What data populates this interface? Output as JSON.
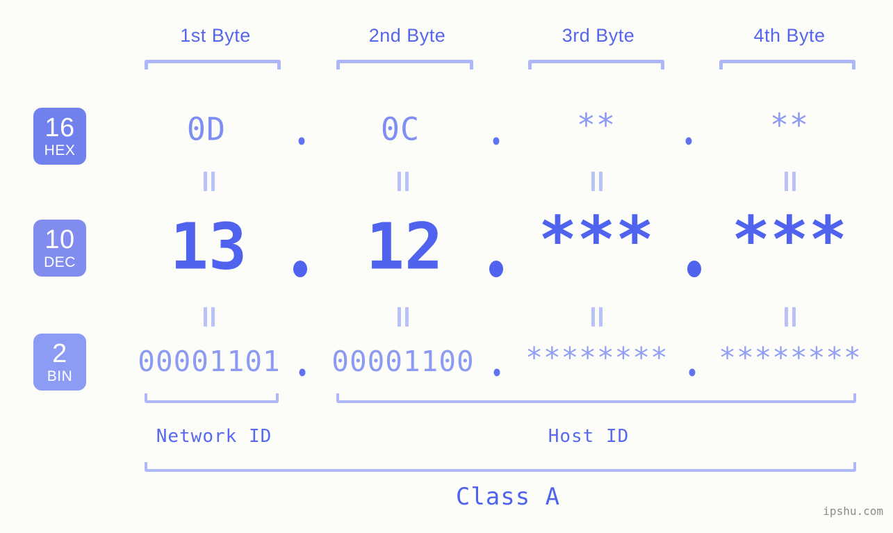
{
  "meta": {
    "background_color": "#fcfdf9",
    "accent_color": "#4f63ee",
    "light_accent_color": "#adb7f7",
    "watermark": "ipshu.com"
  },
  "columns": [
    {
      "label": "1st Byte"
    },
    {
      "label": "2nd Byte"
    },
    {
      "label": "3rd Byte"
    },
    {
      "label": "4th Byte"
    }
  ],
  "rows": [
    {
      "badge_number": "16",
      "badge_name": "HEX",
      "badge_color": "#7080ec",
      "values": [
        "0D",
        "0C",
        "**",
        "**"
      ],
      "separator": "."
    },
    {
      "badge_number": "10",
      "badge_name": "DEC",
      "badge_color": "#808cee",
      "values": [
        "13",
        "12",
        "***",
        "***"
      ],
      "separator": "."
    },
    {
      "badge_number": "2",
      "badge_name": "BIN",
      "badge_color": "#8c9cf4",
      "values": [
        "00001101",
        "00001100",
        "********",
        "********"
      ],
      "separator": "."
    }
  ],
  "sections": [
    {
      "label": "Network ID"
    },
    {
      "label": "Host ID"
    }
  ],
  "class": {
    "label": "Class A"
  },
  "equals_symbol": "||"
}
